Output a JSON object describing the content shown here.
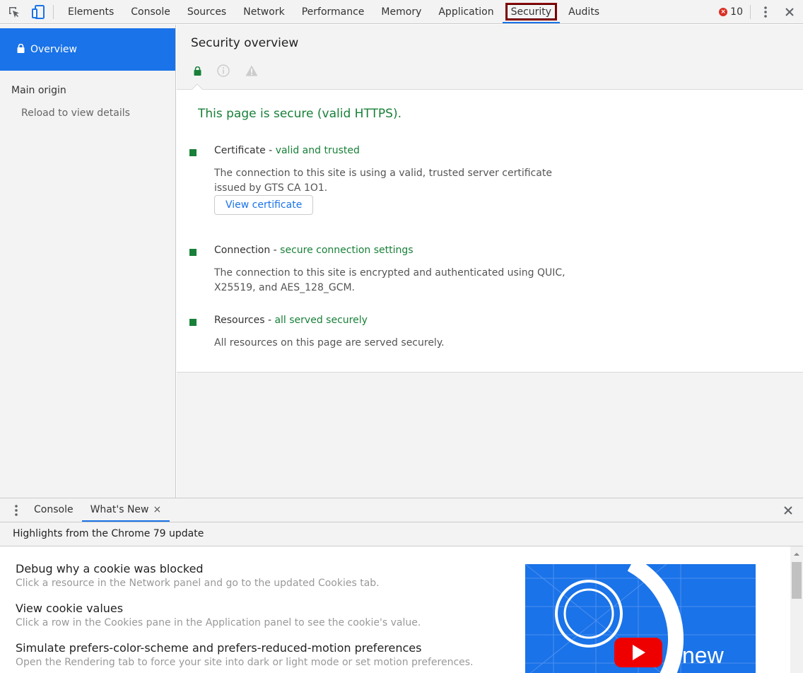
{
  "toolbar": {
    "tabs": [
      "Elements",
      "Console",
      "Sources",
      "Network",
      "Performance",
      "Memory",
      "Application",
      "Security",
      "Audits"
    ],
    "active_tab": "Security",
    "error_count": "10"
  },
  "sidebar": {
    "overview_label": "Overview",
    "main_origin_label": "Main origin",
    "reload_label": "Reload to view details"
  },
  "security": {
    "title": "Security overview",
    "summary": "This page is secure (valid HTTPS).",
    "items": [
      {
        "name": "Certificate",
        "sep": " - ",
        "status": "valid and trusted",
        "description": "The connection to this site is using a valid, trusted server certificate issued by GTS CA 1O1."
      },
      {
        "name": "Connection",
        "sep": " - ",
        "status": "secure connection settings",
        "description": "The connection to this site is encrypted and authenticated using QUIC, X25519, and AES_128_GCM."
      },
      {
        "name": "Resources",
        "sep": " - ",
        "status": "all served securely",
        "description": "All resources on this page are served securely."
      }
    ],
    "view_certificate_label": "View certificate"
  },
  "drawer": {
    "tabs": [
      "Console",
      "What's New"
    ],
    "active_tab": "What's New",
    "close_tab_glyph": "×",
    "subtitle": "Highlights from the Chrome 79 update",
    "news": [
      {
        "title": "Debug why a cookie was blocked",
        "desc": "Click a resource in the Network panel and go to the updated Cookies tab."
      },
      {
        "title": "View cookie values",
        "desc": "Click a row in the Cookies pane in the Application panel to see the cookie's value."
      },
      {
        "title": "Simulate prefers-color-scheme and prefers-reduced-motion preferences",
        "desc": "Open the Rendering tab to force your site into dark or light mode or set motion preferences."
      }
    ],
    "promo_text": "new"
  },
  "colors": {
    "accent": "#1a73e8",
    "secure_green": "#188038",
    "highlight_box": "#8b0000",
    "error_red": "#d93025"
  },
  "icons": [
    "inspect-element-icon",
    "device-toolbar-icon",
    "error-icon",
    "kebab-menu-icon",
    "close-icon",
    "lock-icon",
    "info-icon",
    "warning-icon",
    "drawer-menu-icon",
    "youtube-play-icon"
  ]
}
